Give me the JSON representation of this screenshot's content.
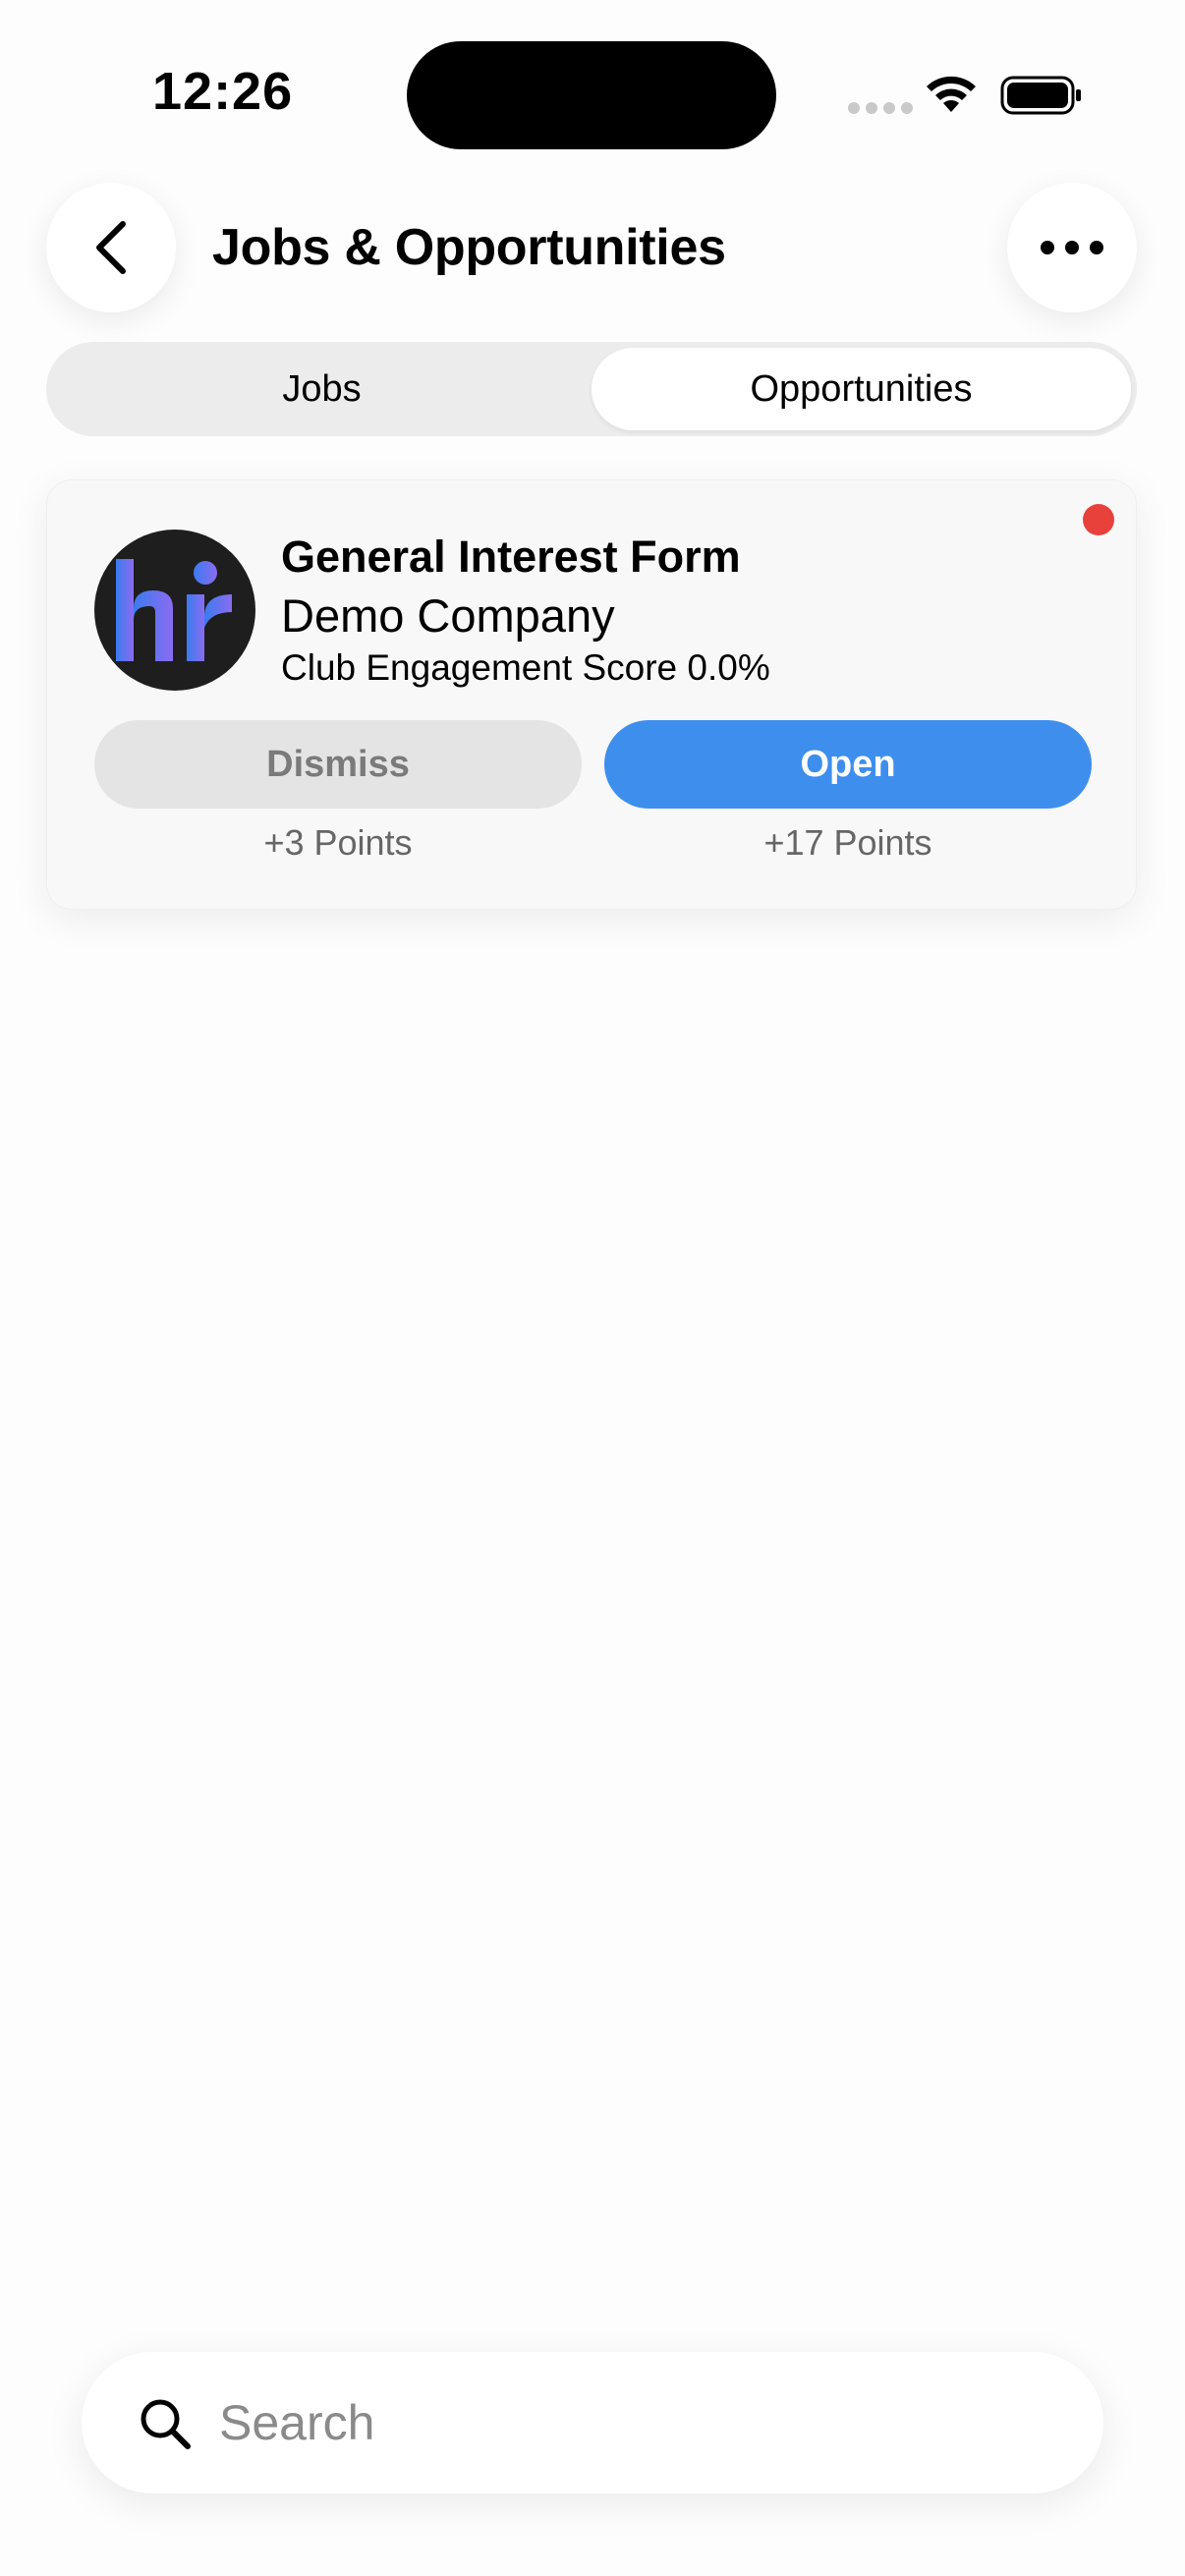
{
  "status_bar": {
    "time": "12:26"
  },
  "header": {
    "title": "Jobs & Opportunities",
    "back_icon": "chevron-left-icon",
    "more_icon": "ellipsis-icon"
  },
  "tabs": [
    {
      "label": "Jobs",
      "active": false
    },
    {
      "label": "Opportunities",
      "active": true
    }
  ],
  "card": {
    "logo_icon": "hr-logo",
    "title": "General Interest Form",
    "company": "Demo Company",
    "score": "Club Engagement Score 0.0%",
    "unread": true,
    "dismiss_label": "Dismiss",
    "dismiss_points": "+3 Points",
    "open_label": "Open",
    "open_points": "+17 Points"
  },
  "search": {
    "placeholder": "Search",
    "value": ""
  },
  "colors": {
    "accent": "#3e8eed",
    "unread_dot": "#e8413b",
    "logo_bg": "#1e1e1e"
  }
}
